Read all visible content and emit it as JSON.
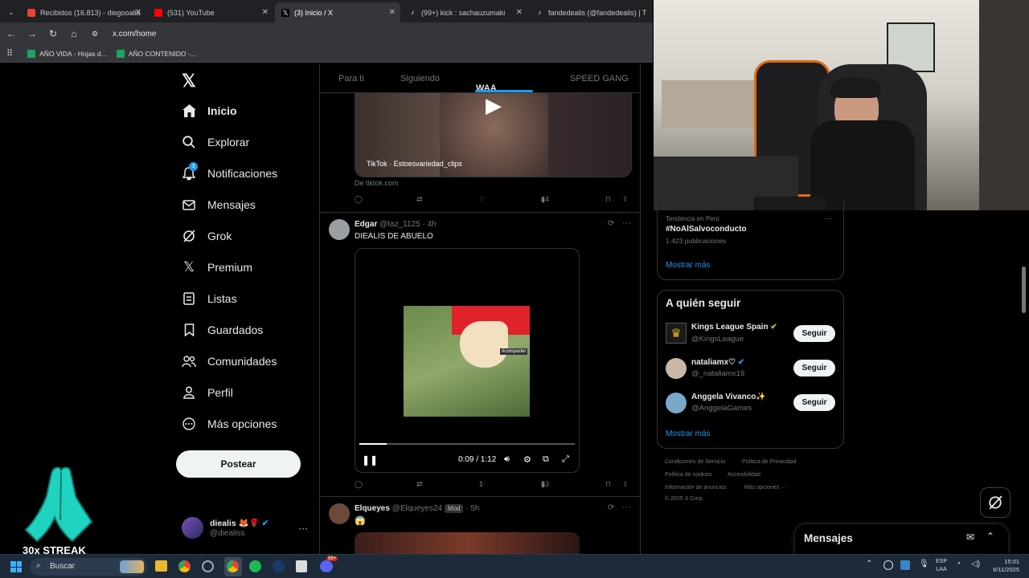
{
  "browser": {
    "tabs": [
      {
        "label": "Recibidos (16.813) - diegooalia",
        "color": "#ea4335"
      },
      {
        "label": "(531) YouTube",
        "color": "#ff0000"
      },
      {
        "label": "(3) Inicio / X",
        "color": "#ffffff"
      },
      {
        "label": "(99+) kick : sachauzumaki",
        "color": "#53fc18"
      },
      {
        "label": "fandedealis (@fandedealis) | T",
        "color": "#ffffff"
      }
    ],
    "url": "x.com/home",
    "bookmarks": [
      "AÑO VIDA - Hojas d...",
      "AÑO CONTENIDO -..."
    ]
  },
  "sidebar": {
    "items": [
      {
        "label": "Inicio"
      },
      {
        "label": "Explorar"
      },
      {
        "label": "Notificaciones",
        "badge": "3"
      },
      {
        "label": "Mensajes"
      },
      {
        "label": "Grok"
      },
      {
        "label": "Premium"
      },
      {
        "label": "Listas"
      },
      {
        "label": "Guardados"
      },
      {
        "label": "Comunidades"
      },
      {
        "label": "Perfil"
      },
      {
        "label": "Más opciones"
      }
    ],
    "post_button": "Postear",
    "account": {
      "name": "diealis 🦊🌹",
      "handle": "@diealiss",
      "more": "···"
    }
  },
  "feed": {
    "tabs": [
      "Para ti",
      "Siguiendo",
      "WAA CREW",
      "SPEED GANG"
    ],
    "prev_post": {
      "card_caption": "TikTok · Estoesvariedad_clips",
      "source": "De tiktok.com",
      "views": "44"
    },
    "post1": {
      "name": "Edgar",
      "handle": "@taz_1125",
      "time": "· 4h",
      "text": "DIEALIS DE ABUELO",
      "video_time": "0:09 / 1:12",
      "progress": 0.125,
      "video_overlay": "#comparter",
      "likes": "1",
      "views": "53"
    },
    "post2": {
      "name": "Elqueyes",
      "handle": "@Elqueyes24",
      "badge": "Mod",
      "time": "· 5h",
      "text": "😱"
    }
  },
  "right": {
    "trend": {
      "context": "Tendencia en Perú",
      "title": "#NoAlSalvoconducto",
      "count": "1.423 publicaciones",
      "more": "···"
    },
    "show_more": "Mostrar más",
    "follow": {
      "title": "A quién seguir",
      "users": [
        {
          "name": "Kings League Spain",
          "handle": "@KingsLeague",
          "button": "Seguir"
        },
        {
          "name": "nataliamx♡",
          "handle": "@_nataliamx19",
          "button": "Seguir"
        },
        {
          "name": "Anggela Vivanco✨",
          "handle": "@AnggelaGames",
          "button": "Seguir"
        }
      ],
      "more": "Mostrar más"
    },
    "footer": [
      "Condiciones de Servicio",
      "Política de Privacidad",
      "Política de cookies",
      "Accesibilidad",
      "Información de anuncios",
      "Más opciones ···",
      "© 2025 X Corp."
    ],
    "messages": "Mensajes"
  },
  "overlay": {
    "streak": "30x STREAK"
  },
  "taskbar": {
    "search": "Buscar",
    "lang": "ESP",
    "lang2": "LAA",
    "time": "15:01",
    "date": "6/11/2025",
    "badge": "99+"
  },
  "colors": {
    "accent": "#1d9bf0",
    "verified": "#1d9bf0",
    "gold": "#e2b719"
  }
}
